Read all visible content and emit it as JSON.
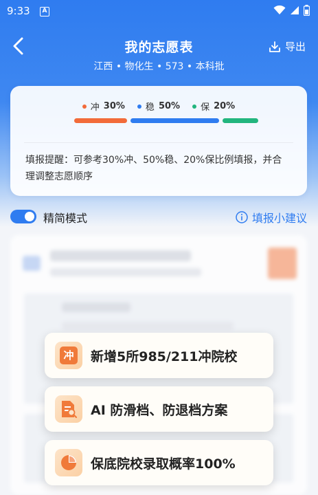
{
  "status_bar": {
    "time": "9:33",
    "app_badge": "A"
  },
  "header": {
    "title": "我的志愿表",
    "subtitle": "江西 • 物化生 • 573 • 本科批",
    "export_label": "导出"
  },
  "ratio": {
    "legend": [
      {
        "label": "冲",
        "value": "30%",
        "color": "#f26b3a",
        "fraction": 0.3
      },
      {
        "label": "稳",
        "value": "50%",
        "color": "#2f7cf0",
        "fraction": 0.5
      },
      {
        "label": "保",
        "value": "20%",
        "color": "#22b57e",
        "fraction": 0.2
      }
    ],
    "tip": "填报提醒：可参考30%冲、50%稳、20%保比例填报，并合理调整志愿顺序"
  },
  "mode": {
    "label": "精简模式",
    "enabled": true,
    "suggest_label": "填报小建议"
  },
  "features": [
    {
      "text": "新增5所985/211冲院校",
      "icon": "chong-icon",
      "icon_text": "冲"
    },
    {
      "text": "AI 防滑档、防退档方案",
      "icon": "document-search-icon"
    },
    {
      "text": "保底院校录取概率100%",
      "icon": "pie-chart-icon"
    }
  ]
}
